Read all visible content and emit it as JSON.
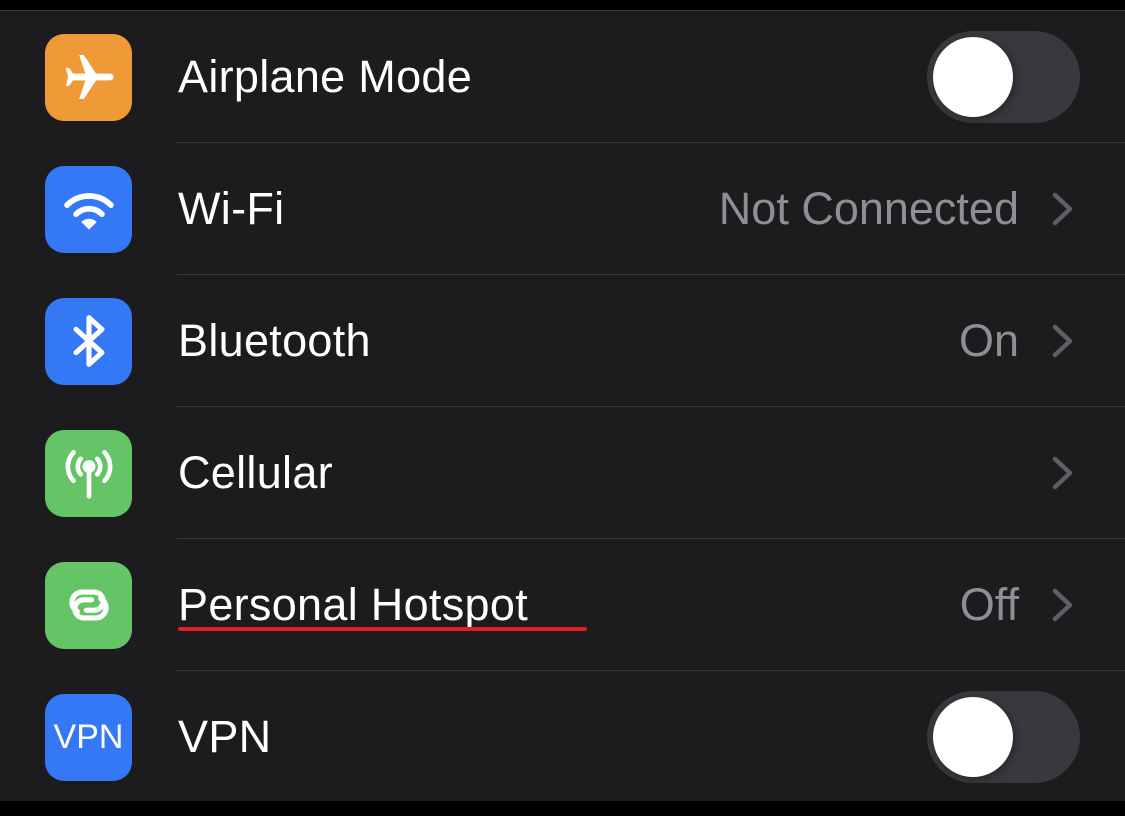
{
  "colors": {
    "airplane": "#f09a37",
    "wifi": "#3478f6",
    "bluetooth": "#3478f6",
    "cellular": "#65c466",
    "hotspot": "#65c466",
    "vpn": "#3478f6",
    "annotation_underline": "#e0201e"
  },
  "rows": [
    {
      "label": "Airplane Mode",
      "icon": "airplane-icon",
      "toggle_on": false
    },
    {
      "label": "Wi-Fi",
      "icon": "wifi-icon",
      "value": "Not Connected"
    },
    {
      "label": "Bluetooth",
      "icon": "bluetooth-icon",
      "value": "On"
    },
    {
      "label": "Cellular",
      "icon": "antenna-icon",
      "value": ""
    },
    {
      "label": "Personal Hotspot",
      "icon": "hotspot-link-icon",
      "value": "Off"
    },
    {
      "label": "VPN",
      "icon": "vpn-icon",
      "icon_text": "VPN",
      "toggle_on": false
    }
  ]
}
